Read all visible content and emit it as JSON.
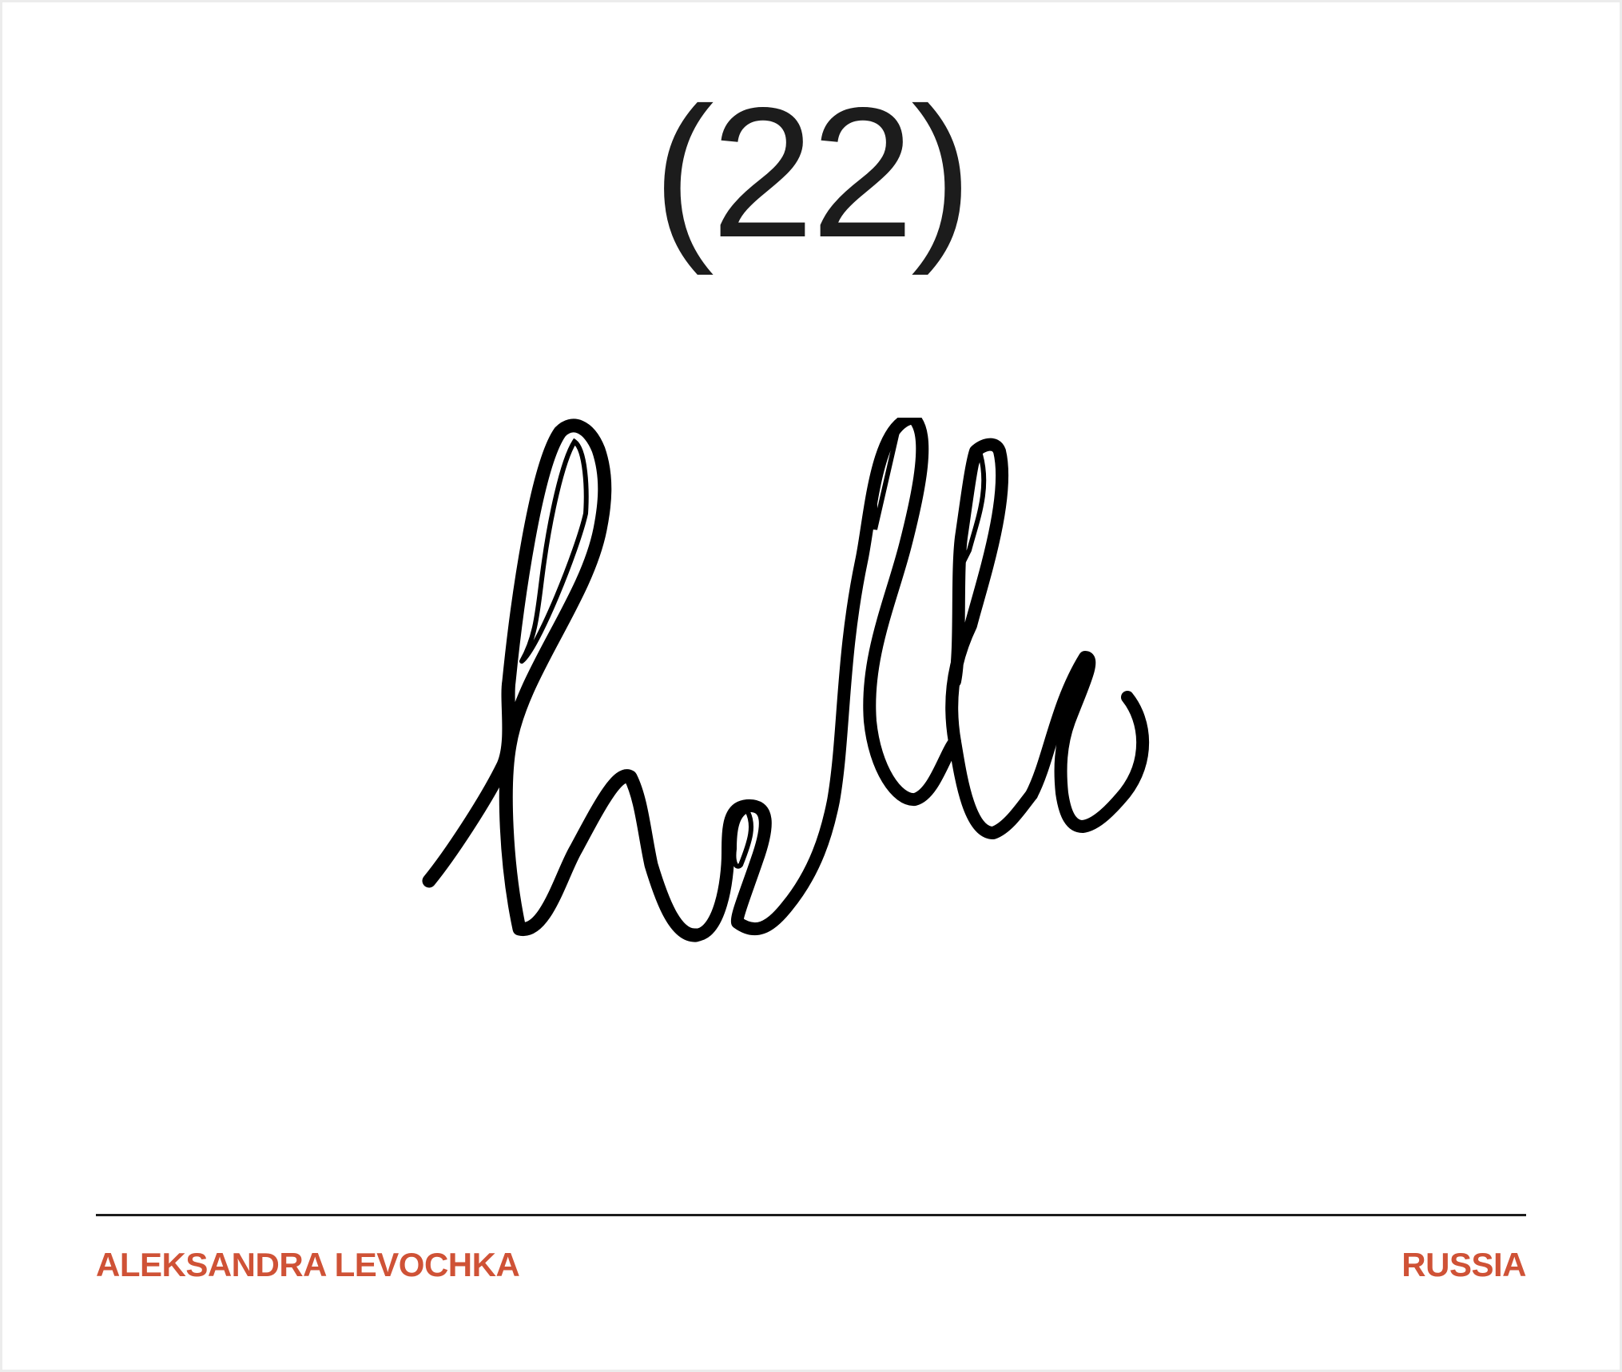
{
  "entry_number": "(22)",
  "artwork": {
    "word": "hello",
    "ink_color": "#000000"
  },
  "footer": {
    "author": "ALEKSANDRA LEVOCHKA",
    "country": "RUSSIA"
  },
  "colors": {
    "background": "#ffffff",
    "frame": "#ececec",
    "number_text": "#1c1c1c",
    "divider": "#1c1c1c",
    "accent": "#cf5236"
  }
}
